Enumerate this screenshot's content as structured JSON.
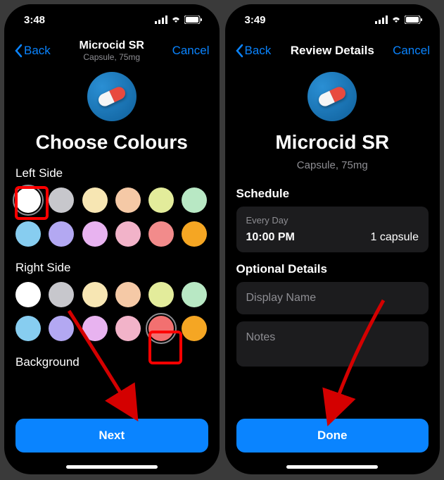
{
  "left_screen": {
    "status_time": "3:48",
    "nav": {
      "back": "Back",
      "title": "Microcid SR",
      "subtitle": "Capsule, 75mg",
      "cancel": "Cancel"
    },
    "heading": "Choose Colours",
    "sections": {
      "left_side_label": "Left Side",
      "right_side_label": "Right Side",
      "background_label": "Background"
    },
    "left_colors": [
      "#ffffff",
      "#c7c7cc",
      "#f7e6b3",
      "#f5c9a6",
      "#e3ec9b",
      "#b8e8c4",
      "#87cdf0",
      "#b3a8f2",
      "#e8b3f0",
      "#f2b3c9",
      "#f28b8b",
      "#f5a623"
    ],
    "right_colors": [
      "#ffffff",
      "#c7c7cc",
      "#f7e6b3",
      "#f5c9a6",
      "#e3ec9b",
      "#b8e8c4",
      "#87cdf0",
      "#b3a8f2",
      "#e8b3f0",
      "#f2b3c9",
      "#f27070",
      "#f5a623"
    ],
    "selected_left_index": 0,
    "selected_right_index": 10,
    "primary_button": "Next"
  },
  "right_screen": {
    "status_time": "3:49",
    "nav": {
      "back": "Back",
      "title": "Review Details",
      "cancel": "Cancel"
    },
    "heading": "Microcid SR",
    "subtitle": "Capsule, 75mg",
    "schedule": {
      "header": "Schedule",
      "frequency": "Every Day",
      "time": "10:00 PM",
      "dose": "1 capsule"
    },
    "optional": {
      "header": "Optional Details",
      "display_name_placeholder": "Display Name",
      "notes_placeholder": "Notes"
    },
    "primary_button": "Done"
  }
}
